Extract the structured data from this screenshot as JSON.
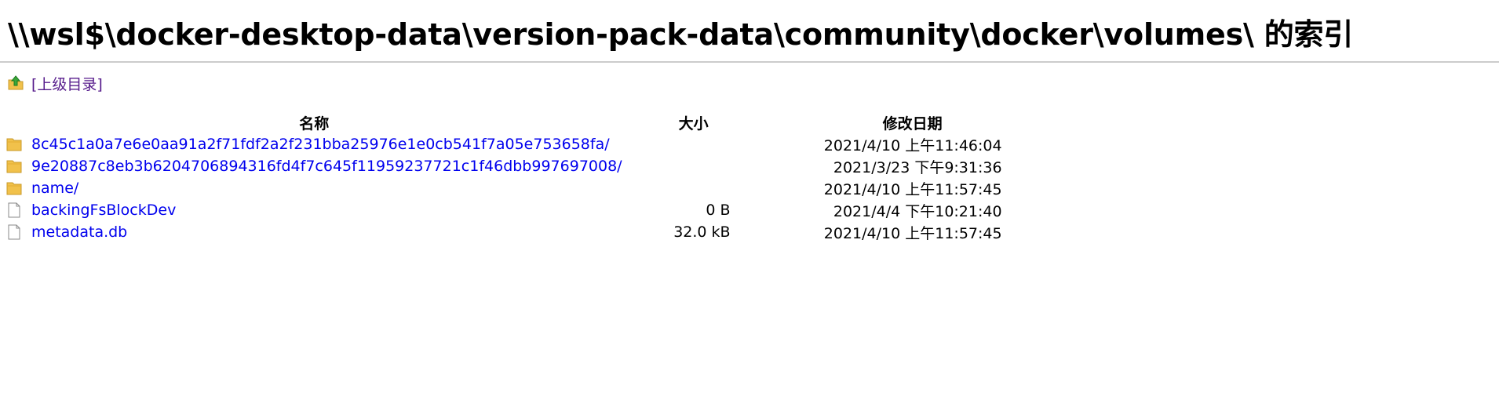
{
  "page": {
    "title": "\\\\wsl$\\docker-desktop-data\\version-pack-data\\community\\docker\\volumes\\ 的索引",
    "parent_link": "[上级目录]"
  },
  "table": {
    "headers": {
      "name": "名称",
      "size": "大小",
      "modified": "修改日期"
    },
    "rows": [
      {
        "type": "folder",
        "name": "8c45c1a0a7e6e0aa91a2f71fdf2a2f231bba25976e1e0cb541f7a05e753658fa/",
        "size": "",
        "modified": "2021/4/10 上午11:46:04"
      },
      {
        "type": "folder",
        "name": "9e20887c8eb3b6204706894316fd4f7c645f11959237721c1f46dbb997697008/",
        "size": "",
        "modified": "2021/3/23 下午9:31:36"
      },
      {
        "type": "folder",
        "name": "name/",
        "size": "",
        "modified": "2021/4/10 上午11:57:45"
      },
      {
        "type": "file",
        "name": "backingFsBlockDev",
        "size": "0 B",
        "modified": "2021/4/4 下午10:21:40"
      },
      {
        "type": "file",
        "name": "metadata.db",
        "size": "32.0 kB",
        "modified": "2021/4/10 上午11:57:45"
      }
    ]
  },
  "icons": {
    "folder": "folder-icon",
    "file": "file-icon",
    "up": "up-directory-icon"
  },
  "colors": {
    "link": "#0000ee",
    "visited_link": "#551a8b",
    "divider": "#cccccc",
    "folder": "#f1c14b"
  }
}
